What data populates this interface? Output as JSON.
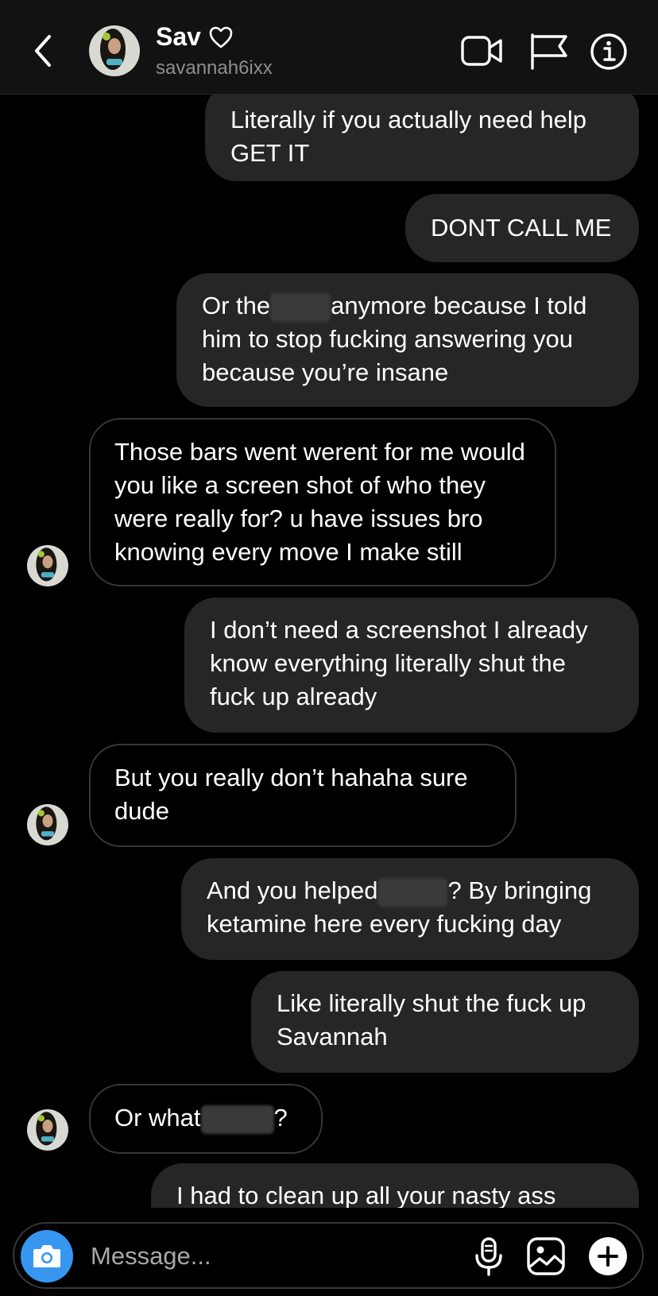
{
  "header": {
    "name": "Sav",
    "name_icon": "heart-outline-icon",
    "username": "savannah6ixx",
    "icons": [
      "back-chevron-icon",
      "video-call-icon",
      "flag-icon",
      "info-icon"
    ]
  },
  "messages": [
    {
      "side": "out",
      "text_before": "Literally if you actually need help GET IT"
    },
    {
      "side": "out",
      "text_before": "DONT CALL ME"
    },
    {
      "side": "out",
      "text_before": "Or the",
      "text_after": "anymore because I told him to stop fucking answering you because you’re insane",
      "redacted": true
    },
    {
      "side": "in",
      "text_before": "Those bars went werent for me would you like a screen shot of who they were really for? u have issues bro knowing every move I make still"
    },
    {
      "side": "out",
      "text_before": "I don’t need a screenshot I already know everything literally shut the fuck up already"
    },
    {
      "side": "in",
      "text_before": "But you really don’t hahaha sure dude"
    },
    {
      "side": "out",
      "text_before": "And you helped",
      "text_after": "? By bringing ketamine here every fucking day",
      "redacted": true
    },
    {
      "side": "out",
      "text_before": "Like literally shut the fuck up Savannah"
    },
    {
      "side": "in",
      "text_before": "Or what",
      "text_after": "?",
      "redacted": true
    },
    {
      "side": "out",
      "text_before": "I had to clean up all your nasty ass"
    }
  ],
  "composer": {
    "placeholder": "Message...",
    "icons": [
      "camera-icon",
      "microphone-icon",
      "gallery-icon",
      "plus-icon"
    ]
  },
  "colors": {
    "background": "#000000",
    "header_bg": "#121212",
    "outgoing_bubble": "#262626",
    "incoming_border": "#363636",
    "camera_button": "#3797f0",
    "secondary_text": "#8e8e8e"
  }
}
